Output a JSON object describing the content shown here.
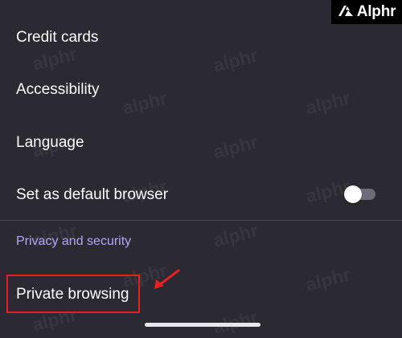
{
  "brand": {
    "logo_text": "Alphr",
    "watermark": "alphr"
  },
  "settings": {
    "items": [
      {
        "label": "Credit cards"
      },
      {
        "label": "Accessibility"
      },
      {
        "label": "Language"
      },
      {
        "label": "Set as default browser",
        "toggle": false
      }
    ],
    "section_header": "Privacy and security",
    "private_browsing_label": "Private browsing"
  },
  "colors": {
    "background": "#2b2a33",
    "text": "#fbfbfe",
    "section_header": "#b5a6ff",
    "highlight": "#e62022"
  },
  "icons": [
    "alphr-logo-icon",
    "red-arrow-icon"
  ]
}
